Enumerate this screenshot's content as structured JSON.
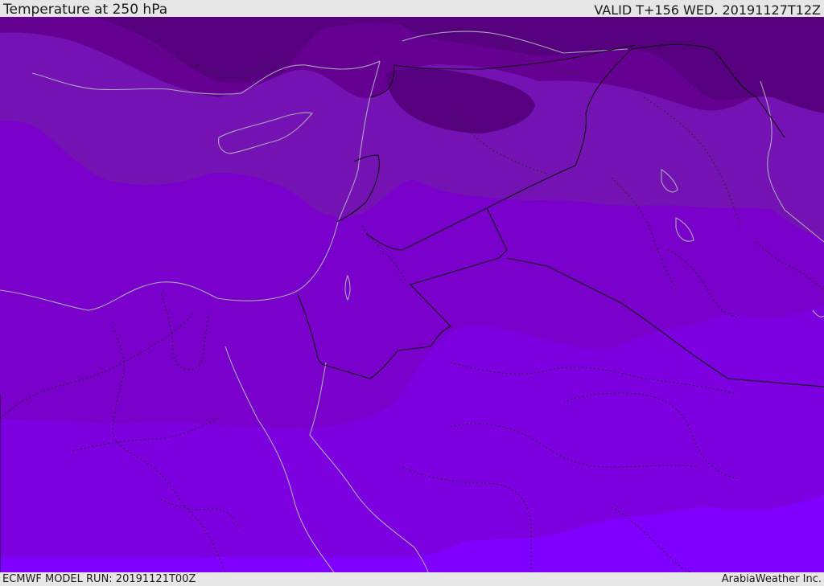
{
  "header": {
    "title": "Temperature at 250 hPa",
    "valid_time": "VALID T+156 WED. 20191127T12Z"
  },
  "footer": {
    "model_run": "ECMWF MODEL RUN: 20191121T00Z",
    "credit": "ArabiaWeather Inc."
  },
  "palette": {
    "coldest": "#560080",
    "colder": "#650093",
    "cold": "#7412b3",
    "mid": "#7a00cc",
    "warm": "#7d00e0",
    "warmest": "#7f00ff",
    "coastline": "#a9a9b8",
    "border": "#111111",
    "subdivision": "#2a2a2a"
  }
}
